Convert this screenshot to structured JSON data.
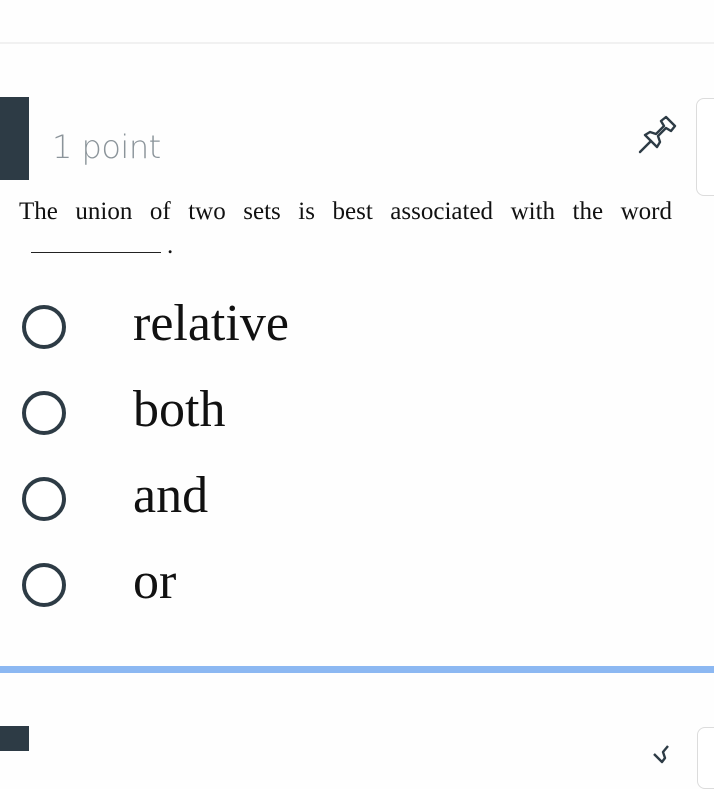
{
  "question": {
    "points_label": "1 point",
    "text_before_blank": "The union of two sets is best associated with the word",
    "text_after_blank": ".",
    "options": [
      {
        "label": "relative",
        "selected": false
      },
      {
        "label": "both",
        "selected": false
      },
      {
        "label": "and",
        "selected": false
      },
      {
        "label": "or",
        "selected": false
      }
    ]
  },
  "icons": {
    "pin": "pin-icon",
    "radio": "radio-unchecked-icon"
  },
  "colors": {
    "marker": "#2d3b45",
    "points_text": "#8b949a",
    "focus_bar": "#8cb8f2"
  }
}
